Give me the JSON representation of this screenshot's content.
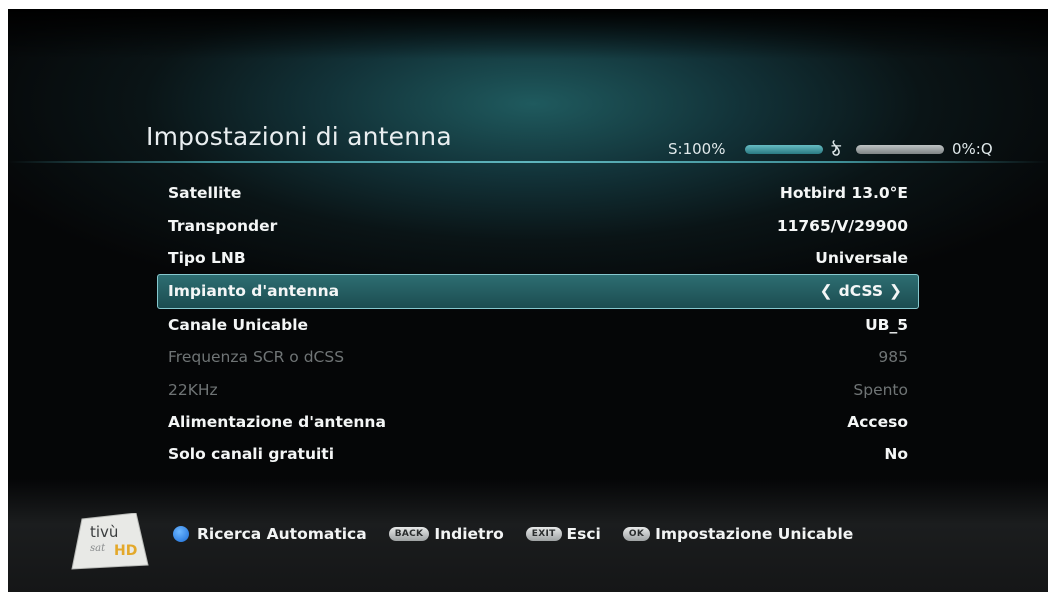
{
  "title": "Impostazioni di antenna",
  "signal": {
    "strength_label": "S:100%",
    "strength_value": 100,
    "quality_label": "0%:Q",
    "quality_value": 0,
    "separator_icon": "swirl-icon"
  },
  "menu": [
    {
      "label": "Satellite",
      "value": "Hotbird 13.0°E",
      "state": "normal"
    },
    {
      "label": "Transponder",
      "value": "11765/V/29900",
      "state": "normal"
    },
    {
      "label": "Tipo LNB",
      "value": "Universale",
      "state": "normal"
    },
    {
      "label": "Impianto d'antenna",
      "value": "dCSS",
      "state": "selected"
    },
    {
      "label": "Canale Unicable",
      "value": "UB_5",
      "state": "normal"
    },
    {
      "label": "Frequenza SCR o dCSS",
      "value": "985",
      "state": "disabled"
    },
    {
      "label": "22KHz",
      "value": "Spento",
      "state": "disabled"
    },
    {
      "label": "Alimentazione d'antenna",
      "value": "Acceso",
      "state": "normal"
    },
    {
      "label": "Solo canali gratuiti",
      "value": "No",
      "state": "normal"
    }
  ],
  "footer": {
    "logo_text_top": "tivù",
    "logo_text_bottom": "sat",
    "logo_badge": "HD",
    "blue_label": "Ricerca Automatica",
    "back_key": "BACK",
    "back_label": "Indietro",
    "exit_key": "EXIT",
    "exit_label": "Esci",
    "ok_key": "OK",
    "ok_label": "Impostazione Unicable"
  },
  "colors": {
    "accent": "#2d6e72",
    "highlight_border": "#86c8ce",
    "disabled_text": "#6f7475"
  }
}
